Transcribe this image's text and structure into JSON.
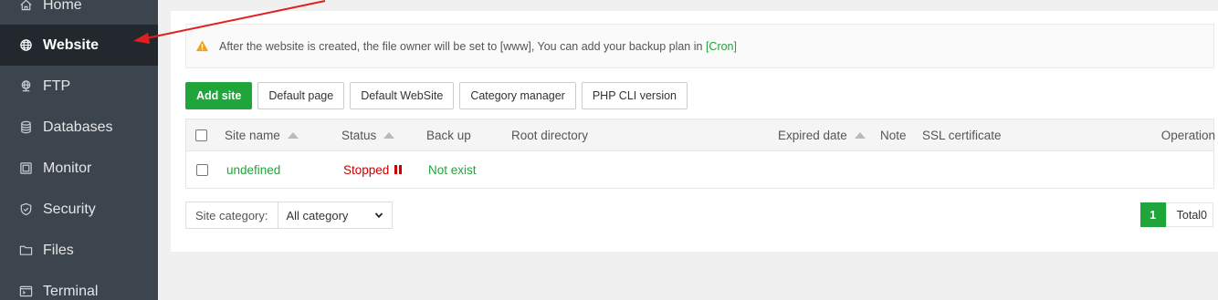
{
  "sidebar": {
    "items": [
      {
        "label": "Home",
        "icon": "home-icon"
      },
      {
        "label": "Website",
        "icon": "globe-icon",
        "active": true
      },
      {
        "label": "FTP",
        "icon": "ftp-icon"
      },
      {
        "label": "Databases",
        "icon": "database-icon"
      },
      {
        "label": "Monitor",
        "icon": "monitor-icon"
      },
      {
        "label": "Security",
        "icon": "shield-icon"
      },
      {
        "label": "Files",
        "icon": "folder-icon"
      },
      {
        "label": "Terminal",
        "icon": "terminal-icon"
      }
    ]
  },
  "notice": {
    "text": "After the website is created, the file owner will be set to [www], You can add your backup plan in ",
    "link": "[Cron]"
  },
  "toolbar": {
    "add_site": "Add site",
    "default_page": "Default page",
    "default_website": "Default WebSite",
    "category_manager": "Category manager",
    "php_cli": "PHP CLI version"
  },
  "table": {
    "headers": {
      "site_name": "Site name",
      "status": "Status",
      "backup": "Back up",
      "root_dir": "Root directory",
      "expired": "Expired date",
      "note": "Note",
      "ssl": "SSL certificate",
      "operation": "Operation"
    },
    "rows": [
      {
        "site_name": "undefined",
        "status": "Stopped",
        "backup": "Not exist"
      }
    ]
  },
  "filter": {
    "label": "Site category:",
    "selected": "All category"
  },
  "pagination": {
    "current": "1",
    "total": "Total0"
  },
  "colors": {
    "accent": "#20a53a",
    "sidebar_bg": "#3c444d",
    "sidebar_active": "#22282e",
    "stopped": "#cc0000",
    "annotation_arrow": "#e02020"
  }
}
